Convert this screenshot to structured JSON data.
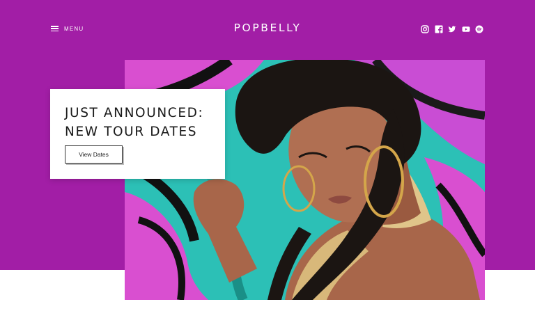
{
  "header": {
    "menu_label": "MENU",
    "logo": "POPBELLY",
    "social_icons": [
      "instagram-icon",
      "facebook-icon",
      "twitter-icon",
      "youtube-icon",
      "spotify-icon"
    ]
  },
  "hero": {
    "headline_line1": "JUST ANNOUNCED:",
    "headline_line2": "NEW TOUR DATES",
    "cta_label": "View Dates"
  },
  "colors": {
    "brand_purple": "#a21ea6",
    "mural_teal": "#2cc0b6",
    "mural_magenta": "#d94fd0"
  }
}
